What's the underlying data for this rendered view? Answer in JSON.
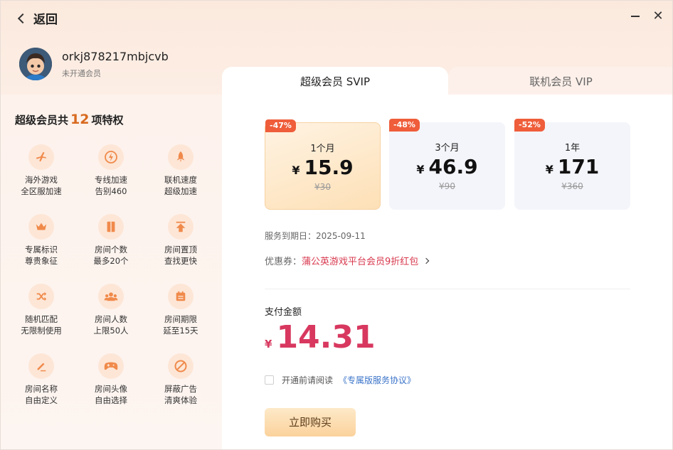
{
  "header": {
    "back_label": "返回"
  },
  "user": {
    "name": "orkj878217mbjcvb",
    "status": "未开通会员"
  },
  "perks": {
    "title_prefix": "超级会员共",
    "count": "12",
    "title_suffix": "项特权",
    "items": [
      {
        "icon": "airplane-icon",
        "line1": "海外游戏",
        "line2": "全区服加速"
      },
      {
        "icon": "lightning-icon",
        "line1": "专线加速",
        "line2": "告别460"
      },
      {
        "icon": "rocket-icon",
        "line1": "联机速度",
        "line2": "超级加速"
      },
      {
        "icon": "crown-icon",
        "line1": "专属标识",
        "line2": "尊贵象征"
      },
      {
        "icon": "door-icon",
        "line1": "房间个数",
        "line2": "最多20个"
      },
      {
        "icon": "pin-top-icon",
        "line1": "房间置顶",
        "line2": "查找更快"
      },
      {
        "icon": "shuffle-icon",
        "line1": "随机匹配",
        "line2": "无限制使用"
      },
      {
        "icon": "group-icon",
        "line1": "房间人数",
        "line2": "上限50人"
      },
      {
        "icon": "calendar-icon",
        "line1": "房间期限",
        "line2": "延至15天"
      },
      {
        "icon": "edit-icon",
        "line1": "房间名称",
        "line2": "自由定义"
      },
      {
        "icon": "gamepad-icon",
        "line1": "房间头像",
        "line2": "自由选择"
      },
      {
        "icon": "block-icon",
        "line1": "屏蔽广告",
        "line2": "清爽体验"
      }
    ]
  },
  "tabs": {
    "svip": "超级会员 SVIP",
    "vip": "联机会员 VIP"
  },
  "plans": [
    {
      "badge": "-47%",
      "duration": "1个月",
      "currency": "¥",
      "price": "15.9",
      "original": "¥30"
    },
    {
      "badge": "-48%",
      "duration": "3个月",
      "currency": "¥",
      "price": "46.9",
      "original": "¥90"
    },
    {
      "badge": "-52%",
      "duration": "1年",
      "currency": "¥",
      "price": "171",
      "original": "¥360"
    }
  ],
  "service": {
    "expire": "服务到期日：2025-09-11"
  },
  "coupon": {
    "label": "优惠券：",
    "value": "蒲公英游戏平台会员9折红包"
  },
  "payment": {
    "label": "支付金额",
    "currency": "¥",
    "amount": "14.31"
  },
  "agreement": {
    "text": "开通前请阅读",
    "link": "《专属版服务协议》"
  },
  "buy_button": "立即购买",
  "colors": {
    "accent": "#d8385f",
    "badge": "#ef5d3a",
    "link": "#3a73c9",
    "perk_count": "#d86a1f"
  }
}
